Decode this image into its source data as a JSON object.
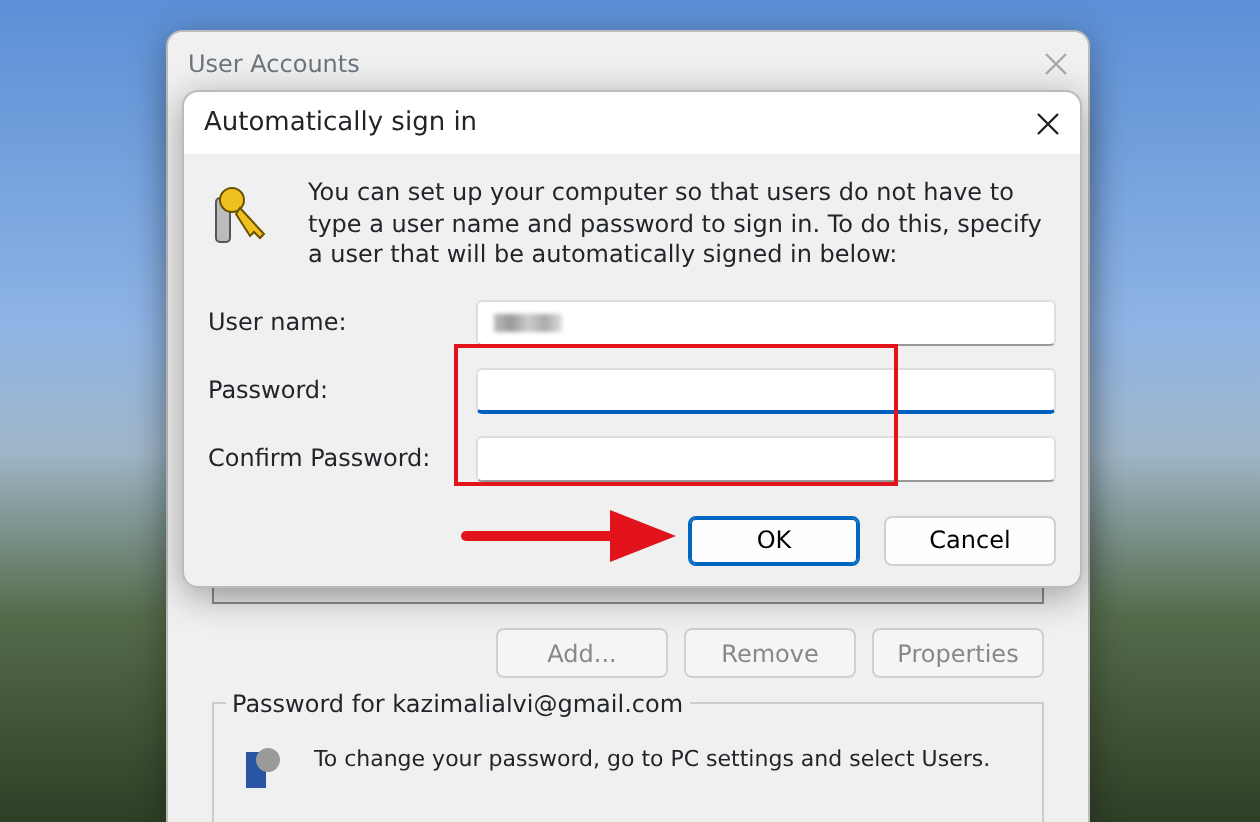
{
  "back_window": {
    "title": "User Accounts",
    "buttons": [
      {
        "label": "Add...",
        "disabled": true
      },
      {
        "label": "Remove",
        "disabled": true
      },
      {
        "label": "Properties",
        "disabled": true
      }
    ],
    "group_title": "Password for kazimalialvi@gmail.com",
    "group_text": "To change your password, go to PC settings and select Users."
  },
  "dialog": {
    "title": "Automatically sign in",
    "message": "You can set up your computer so that users do not have to type a user name and password to sign in. To do this, specify a user that will be automatically signed in below:",
    "fields": [
      {
        "label": "User name:",
        "redacted": true,
        "focused": false
      },
      {
        "label": "Password:",
        "redacted": false,
        "focused": true
      },
      {
        "label": "Confirm Password:",
        "redacted": false,
        "focused": false
      }
    ],
    "buttons": [
      {
        "label": "OK",
        "default": true
      },
      {
        "label": "Cancel",
        "default": false
      }
    ]
  }
}
